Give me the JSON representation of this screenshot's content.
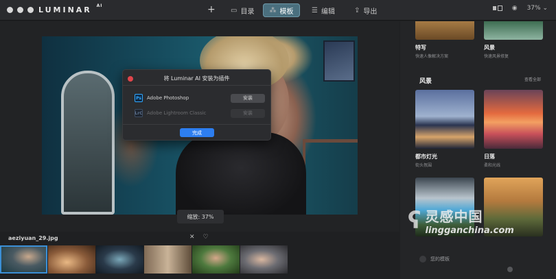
{
  "app": {
    "brand": "LUMINAR",
    "brand_sup": "AI"
  },
  "toolbar": {
    "add_symbol": "+",
    "tabs": [
      {
        "label": "目录",
        "icon": "folder-icon"
      },
      {
        "label": "模板",
        "icon": "magic-wand-icon",
        "active": true
      },
      {
        "label": "编辑",
        "icon": "sliders-icon"
      },
      {
        "label": "导出",
        "icon": "share-icon"
      }
    ],
    "zoom_level": "37%"
  },
  "dialog": {
    "title": "将 Luminar AI 安装为插件",
    "rows": [
      {
        "icon_text": "Ps",
        "name": "Adobe Photoshop",
        "button": "安装",
        "enabled": true
      },
      {
        "icon_text": "LrC",
        "name": "Adobe Lightroom Classic",
        "button": "安装",
        "enabled": false
      }
    ],
    "done_label": "完成"
  },
  "viewer": {
    "zoom_label": "缩放: 37%"
  },
  "filmstrip": {
    "filename": "aeziyuan_29.jpg",
    "thumb_count": 6,
    "selected_index": 0
  },
  "panel": {
    "top_cards": [
      {
        "name": "特写",
        "desc": "快速人像解决方案"
      },
      {
        "name": "风景",
        "desc": "快速风景修复"
      }
    ],
    "section_title": "风景",
    "see_all": "查看全部",
    "cards": [
      {
        "name": "都市灯光",
        "desc": "街头氛围"
      },
      {
        "name": "日落",
        "desc": "柔和光线"
      }
    ],
    "your_templates": "您的模板"
  },
  "watermark": {
    "cn": "灵感中国",
    "en": "lingganchina.com"
  },
  "colors": {
    "accent": "#2d7ef0",
    "active_tab": "#4a6f7e",
    "close": "#e0454b"
  }
}
